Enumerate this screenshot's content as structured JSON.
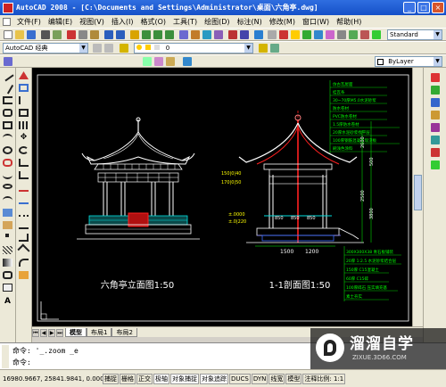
{
  "window": {
    "title": "AutoCAD 2008 - [C:\\Documents and Settings\\Administrator\\桌面\\六角亭.dwg]",
    "controls": {
      "minimize": "_",
      "maximize": "□",
      "close": "×"
    }
  },
  "menu": {
    "items": [
      "文件(F)",
      "编辑(E)",
      "视图(V)",
      "插入(I)",
      "格式(O)",
      "工具(T)",
      "绘图(D)",
      "标注(N)",
      "修改(M)",
      "窗口(W)",
      "帮助(H)"
    ]
  },
  "toolbars": {
    "text_style": "Standard",
    "workspace": "AutoCAD 经典",
    "layer": "0",
    "color": "ByLayer"
  },
  "drawing": {
    "elevation_title": "六角亭立面图1:50",
    "section_title": "1-1剖面图1:50",
    "left_dims": [
      "150|0|40",
      "170|0|50",
      "±.0000",
      "±.0|220"
    ],
    "bottom_dims": [
      "1500",
      "1200"
    ],
    "mid_dims": [
      "850",
      "850",
      "850"
    ],
    "height_dims": [
      "2500",
      "3800",
      "500",
      "2600"
    ],
    "bottom_notes": [
      "300X300X38 青石板铺装",
      "20厚 1:2.5 水泥砂浆结合层",
      "150厚 C15混凝土",
      "60厚 C15碎",
      "100厚碎石 压实填充基",
      "素土夯实"
    ],
    "roof_notes": [
      "仿古瓦屋面",
      "挂瓦条",
      "30~70厚M5.0水泥砂浆",
      "防水卷材",
      "PVC防水卷材",
      "1.5厚防水卷材",
      "20厚水泥砂浆找平层",
      "100厚钢筋混凝土现浇板",
      "刷浅色涂料"
    ]
  },
  "layout_tabs": [
    "模型",
    "布局1",
    "布局2"
  ],
  "command": {
    "line1": "命令: '_.zoom _e",
    "line2": "命令:"
  },
  "status": {
    "coords": "16980.9667, 25841.9841, 0.0000",
    "buttons": [
      "捕捉",
      "栅格",
      "正交",
      "极轴",
      "对象捕捉",
      "对象追踪",
      "DUCS",
      "DYN",
      "线宽",
      "模型"
    ],
    "annotation_scale": "注释比例: 1:1"
  },
  "watermark": {
    "title": "溜溜自学",
    "url": "ZIXUE.3D66.COM"
  },
  "colors": {
    "canvas": "#000000",
    "title_bar": "#1f5fd6",
    "roof_red": "#ff2020",
    "line_white": "#ffffff",
    "dim_green": "#00ff00",
    "cyan": "#00e0e0",
    "yellow": "#ffff00"
  }
}
